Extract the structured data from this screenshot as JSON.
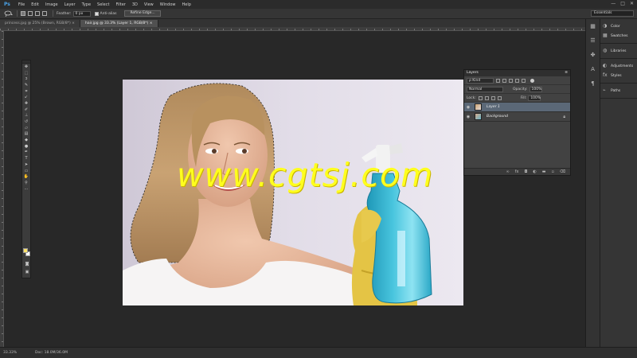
{
  "app": {
    "logo": "Ps",
    "menu": [
      "File",
      "Edit",
      "Image",
      "Layer",
      "Type",
      "Select",
      "Filter",
      "3D",
      "View",
      "Window",
      "Help"
    ],
    "window_controls": [
      "—",
      "□",
      "✕"
    ]
  },
  "options": {
    "feather_label": "Feather:",
    "feather_value": "0 px",
    "antialias_label": "Anti-alias",
    "refine_label": "Refine Edge...",
    "workspace": "Essentials"
  },
  "tabs": [
    {
      "label": "princess.jpg @ 25% (Brown, RGB/8*) ×",
      "active": false
    },
    {
      "label": "hair.jpg @ 33.3% (Layer 1, RGB/8*) ×",
      "active": true
    }
  ],
  "watermark": "www.cgtsj.com",
  "dock": {
    "groups": [
      [
        "Color",
        "Swatches"
      ],
      [
        "Libraries"
      ],
      [
        "Adjustments",
        "Styles"
      ],
      [
        "Paths"
      ]
    ],
    "icons": [
      "palette-icon",
      "swatches-icon",
      "libraries-icon",
      "adjustments-icon",
      "styles-icon",
      "paths-icon"
    ]
  },
  "layers": {
    "title": "Layers",
    "menu": "≡",
    "filter": "ρ Kind",
    "blend_mode": "Normal",
    "opacity_label": "Opacity:",
    "opacity_value": "100%",
    "lock_label": "Lock:",
    "fill_label": "Fill:",
    "fill_value": "100%",
    "items": [
      {
        "name": "Layer 1",
        "active": true,
        "locked": false
      },
      {
        "name": "Background",
        "active": false,
        "locked": true
      }
    ],
    "footer_icons": [
      "link-icon",
      "fx-icon",
      "mask-icon",
      "adjustment-icon",
      "folder-icon",
      "new-layer-icon",
      "trash-icon"
    ]
  },
  "status": {
    "zoom": "33.33%",
    "doc": "Doc: 18.0M/36.0M"
  },
  "colors": {
    "foreground": "#ffe36a",
    "background": "#ffffff",
    "watermark": "#ffff1e",
    "selected_layer": "#5b6877"
  }
}
